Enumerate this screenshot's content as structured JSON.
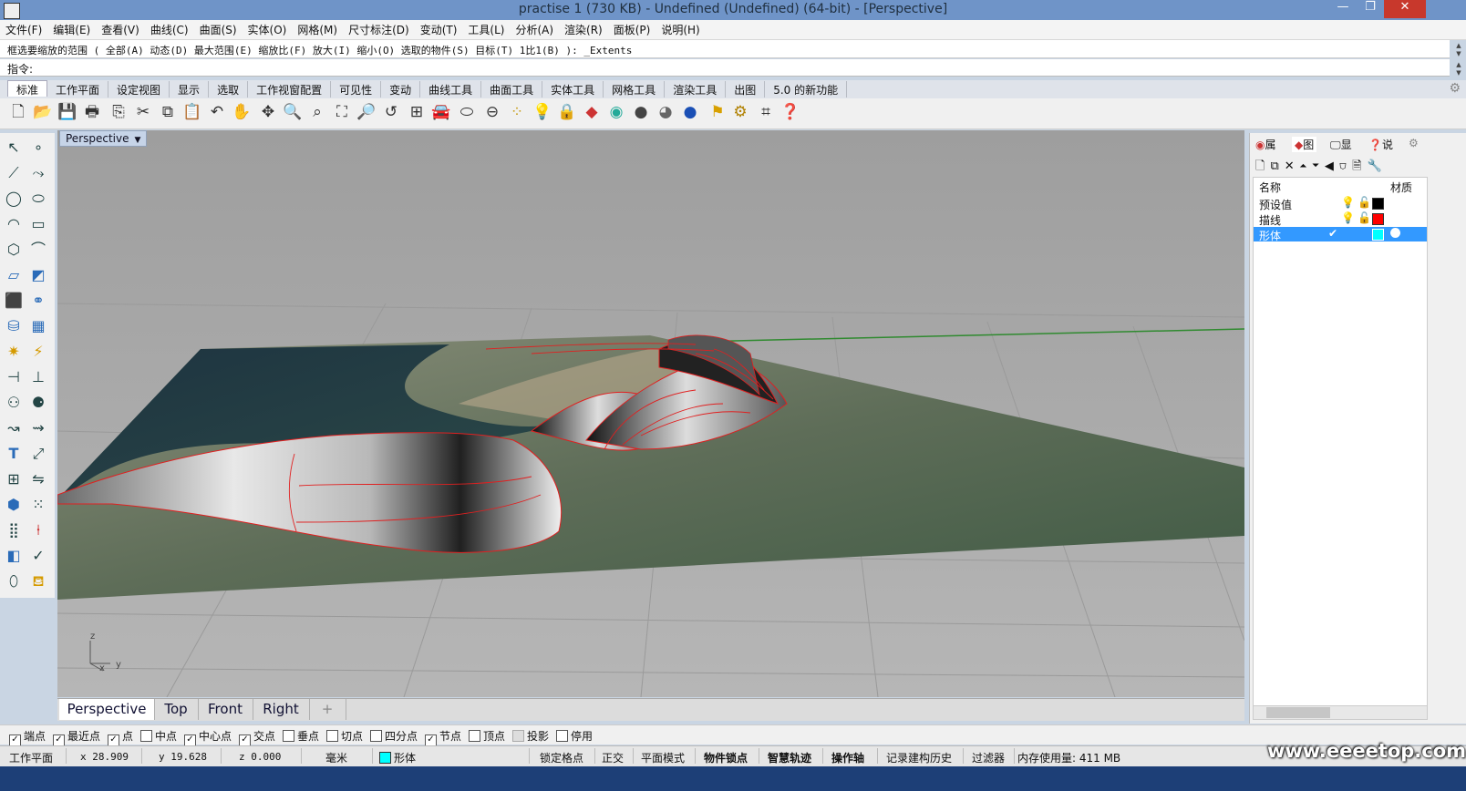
{
  "window": {
    "title": "practise 1 (730 KB) - Undefined (Undefined) (64-bit) - [Perspective]",
    "controls": [
      "—",
      "❐",
      "✕"
    ]
  },
  "menu": [
    "文件(F)",
    "编辑(E)",
    "查看(V)",
    "曲线(C)",
    "曲面(S)",
    "实体(O)",
    "网格(M)",
    "尺寸标注(D)",
    "变动(T)",
    "工具(L)",
    "分析(A)",
    "渲染(R)",
    "面板(P)",
    "说明(H)"
  ],
  "command": {
    "history": "框选要缩放的范围 ( 全部(A) 动态(D) 最大范围(E) 缩放比(F) 放大(I) 缩小(O) 选取的物件(S) 目标(T) 1比1(B) ): _Extents",
    "prompt_label": "指令:",
    "value": ""
  },
  "toolbar_tabs": [
    "标准",
    "工作平面",
    "设定视图",
    "显示",
    "选取",
    "工作视窗配置",
    "可见性",
    "变动",
    "曲线工具",
    "曲面工具",
    "实体工具",
    "网格工具",
    "渲染工具",
    "出图",
    "5.0 的新功能"
  ],
  "toolbar_icons": [
    "new-icon",
    "open-icon",
    "save-icon",
    "print-icon",
    "import-icon",
    "cut-icon",
    "copy-icon",
    "paste-icon",
    "undo-icon",
    "pan-icon",
    "rotate-view-icon",
    "zoom-icon",
    "zoom-window-icon",
    "zoom-extents-icon",
    "zoom-selected-icon",
    "zoom-all-icon",
    "four-views-icon",
    "car-icon",
    "plane-icon",
    "properties-icon",
    "points-icon",
    "light-icon",
    "lock-icon",
    "layer-icon",
    "color-wheel-icon",
    "shaded-sphere-icon",
    "render-sphere-icon",
    "rendered-sphere-icon",
    "lamp-icon",
    "options-gear-icon",
    "snap-icon",
    "help-icon"
  ],
  "viewport": {
    "label": "Perspective",
    "axes": {
      "z": "z",
      "x": "x",
      "y": "y"
    }
  },
  "viewport_tabs": [
    "Perspective",
    "Top",
    "Front",
    "Right"
  ],
  "viewport_tab_add": "+",
  "osnaps": [
    {
      "label": "端点",
      "checked": true
    },
    {
      "label": "最近点",
      "checked": true
    },
    {
      "label": "点",
      "checked": true
    },
    {
      "label": "中点",
      "checked": false
    },
    {
      "label": "中心点",
      "checked": true
    },
    {
      "label": "交点",
      "checked": true
    },
    {
      "label": "垂点",
      "checked": false
    },
    {
      "label": "切点",
      "checked": false
    },
    {
      "label": "四分点",
      "checked": false
    },
    {
      "label": "节点",
      "checked": true
    },
    {
      "label": "顶点",
      "checked": false
    },
    {
      "label": "投影",
      "checked": false
    },
    {
      "label": "停用",
      "checked": false
    }
  ],
  "status": {
    "cplane": "工作平面",
    "x": "x 28.909",
    "y": "y 19.628",
    "z": "z 0.000",
    "units": "毫米",
    "layer": "形体",
    "layer_color": "#00ffff",
    "toggles": [
      "锁定格点",
      "正交",
      "平面模式",
      "物件锁点",
      "智慧轨迹",
      "操作轴",
      "记录建构历史",
      "过滤器"
    ],
    "memory": "内存使用量: 411 MB"
  },
  "panel": {
    "tabs": [
      "属",
      "图",
      "显",
      "说"
    ],
    "columns": {
      "name": "名称",
      "material": "材质"
    },
    "layers": [
      {
        "name": "预设值",
        "color": "#000000",
        "current": false,
        "selected": false
      },
      {
        "name": "描线",
        "color": "#ff0000",
        "current": false,
        "selected": false
      },
      {
        "name": "形体",
        "color": "#00ffff",
        "current": true,
        "selected": true
      }
    ]
  },
  "watermark": "www.eeeetop.com"
}
